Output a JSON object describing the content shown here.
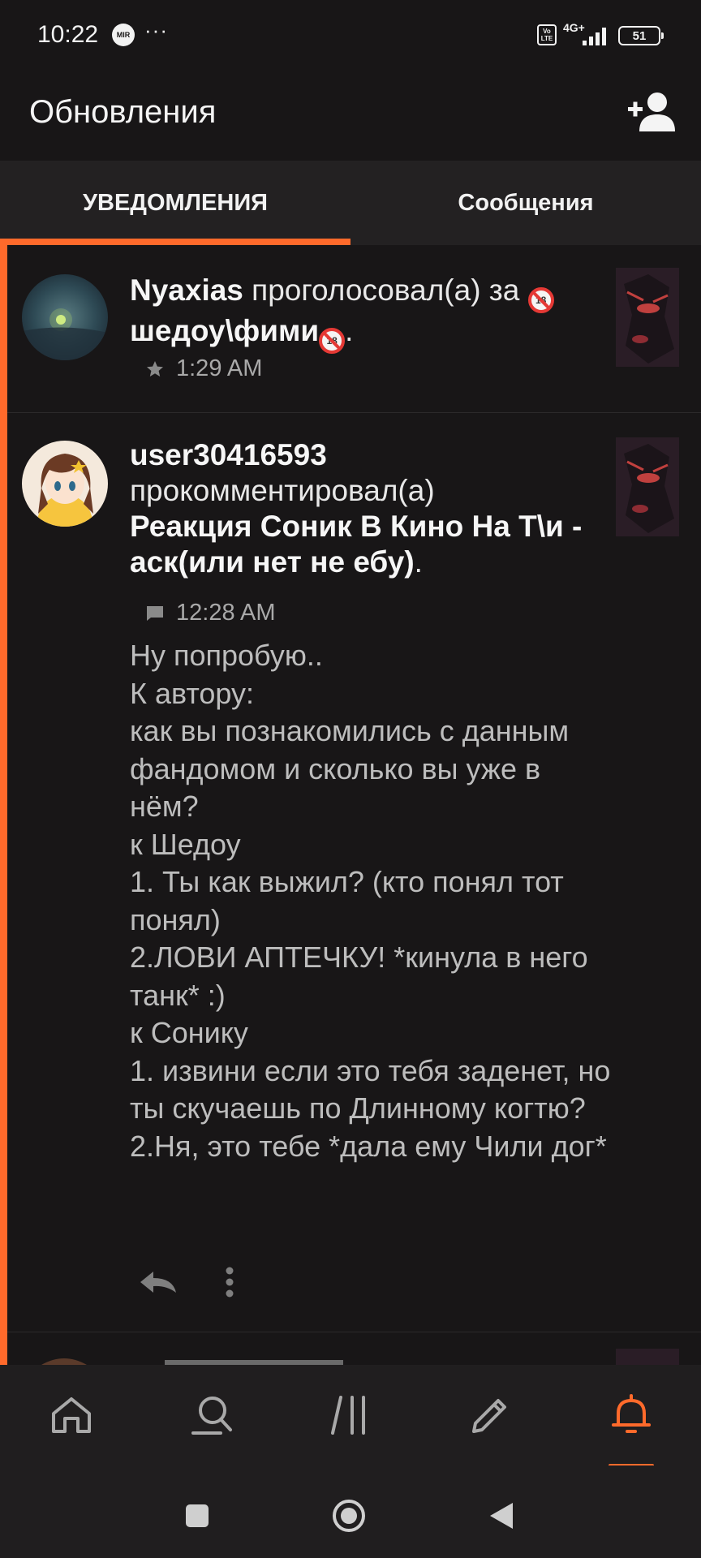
{
  "status_bar": {
    "time": "10:22",
    "mir_label": "MIR",
    "more_dots": "···",
    "volte_label": "Vo LTE",
    "network": "4G+",
    "battery": "51"
  },
  "header": {
    "title": "Обновления",
    "add_user_icon": "add-user-icon"
  },
  "tabs": [
    {
      "label": "УВЕДОМЛЕНИЯ",
      "active": true
    },
    {
      "label": "Сообщения",
      "active": false
    }
  ],
  "notifications": [
    {
      "user": "Nyaxias",
      "action": " проголосовал(а) за ",
      "target": "шедоу\\фими",
      "target_suffix": ".",
      "time": "1:29 AM",
      "icon": "star-icon"
    },
    {
      "user": "user30416593",
      "action": "прокомментировал(а)",
      "target": "Реакция Соник В Кино На Т\\и - аск(или нет не ебу)",
      "target_suffix": ".",
      "time": "12:28 AM",
      "icon": "comment-icon",
      "comment": "Ну попробую..\nК автору:\nкак вы познакомились с данным фандомом и сколько вы уже в нём?\nк Шедоу\n1. Ты как выжил? (кто понял тот понял)\n2.ЛОВИ АПТЕЧКУ! *кинула в него танк* :)\nк Сонику\n1. извини если это тебя заденет, но ты скучаешь по Длинному когтю?\n2.Ня, это тебе *дала ему Чили дог*"
    }
  ],
  "bottom_nav": [
    "home-icon",
    "search-icon",
    "library-icon",
    "write-icon",
    "bell-icon"
  ],
  "system_nav": [
    "recents-icon",
    "home-circle-icon",
    "back-icon"
  ],
  "colors": {
    "accent": "#ff6a2b",
    "background": "#181617",
    "tab_bar": "#232122"
  }
}
